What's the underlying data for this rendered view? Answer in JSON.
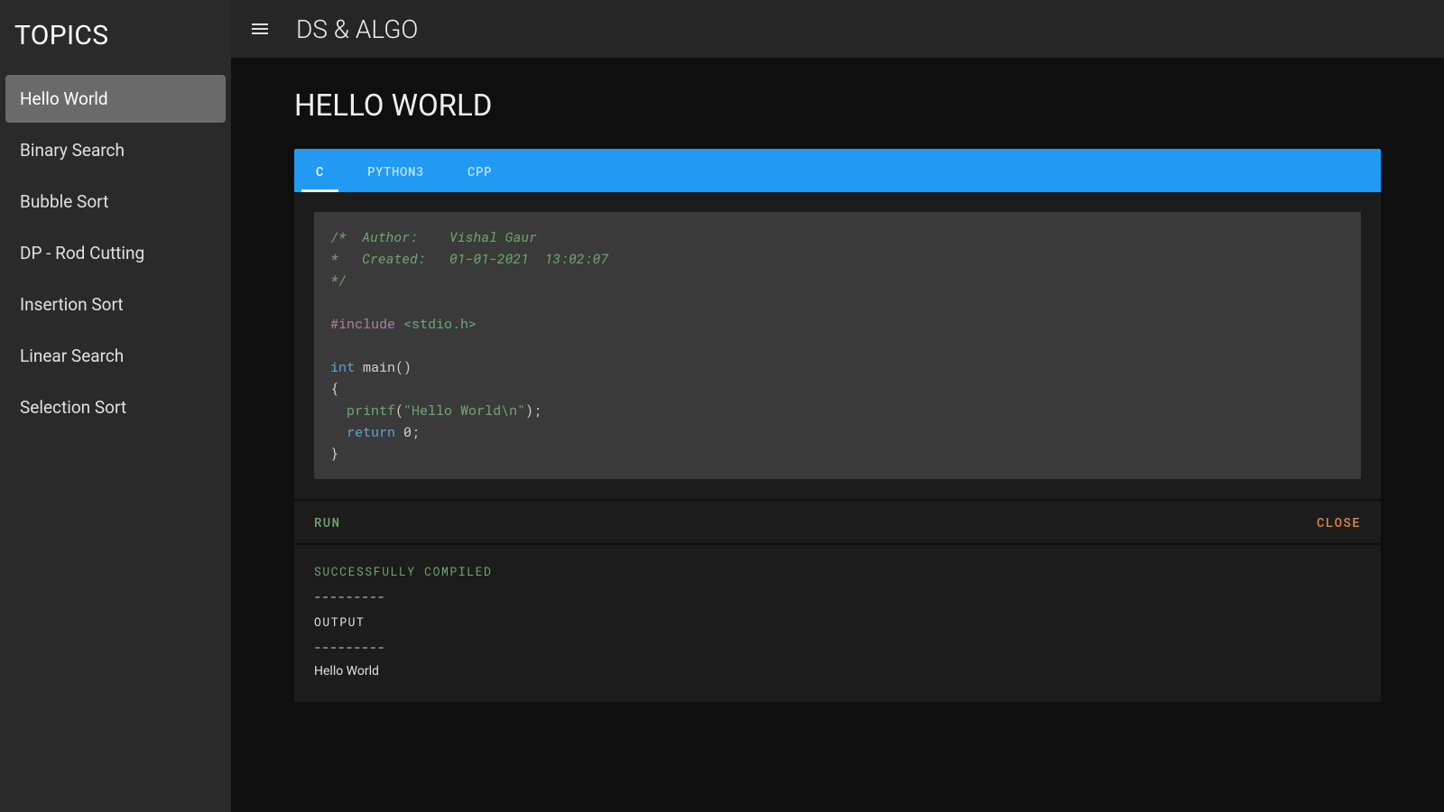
{
  "sidebar": {
    "title": "TOPICS",
    "items": [
      {
        "label": "Hello World",
        "active": true
      },
      {
        "label": "Binary Search",
        "active": false
      },
      {
        "label": "Bubble Sort",
        "active": false
      },
      {
        "label": "DP - Rod Cutting",
        "active": false
      },
      {
        "label": "Insertion Sort",
        "active": false
      },
      {
        "label": "Linear Search",
        "active": false
      },
      {
        "label": "Selection Sort",
        "active": false
      }
    ]
  },
  "header": {
    "title": "DS & ALGO"
  },
  "page": {
    "title": "HELLO WORLD"
  },
  "tabs": [
    {
      "label": "C",
      "active": true
    },
    {
      "label": "PYTHON3",
      "active": false
    },
    {
      "label": "CPP",
      "active": false
    }
  ],
  "code": {
    "comment1": "/*  Author:    Vishal Gaur",
    "comment2": "*   Created:   01-01-2021  13:02:07",
    "comment3": "*/",
    "include_kw": "#include",
    "include_hdr": "<stdio.h>",
    "int_kw": "int",
    "main_sig": " main()",
    "lbrace": "{",
    "printf": "printf",
    "printf_open": "(",
    "printf_str": "\"Hello World\\n\"",
    "printf_close": ");",
    "return_kw": "return",
    "return_rest": " 0;",
    "rbrace": "}"
  },
  "actions": {
    "run": "RUN",
    "close": "CLOSE"
  },
  "output": {
    "compiled": "SUCCESSFULLY COMPILED",
    "sep": "---------",
    "label": "OUTPUT",
    "text": "Hello World"
  }
}
